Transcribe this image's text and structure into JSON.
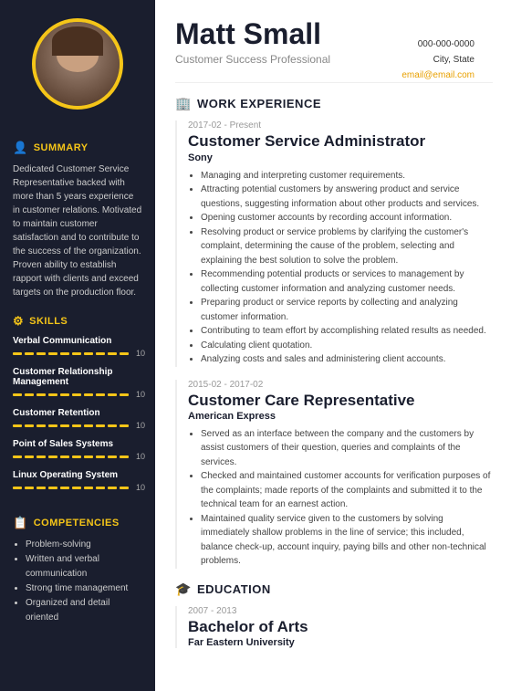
{
  "sidebar": {
    "summary_title": "SUMMARY",
    "summary_text": "Dedicated Customer Service Representative backed with more than 5 years experience in customer relations. Motivated to maintain customer satisfaction and to contribute to the success of the organization. Proven ability to establish rapport with clients and exceed targets on the production floor.",
    "skills_title": "SKILLS",
    "skills": [
      {
        "name": "Verbal Communication",
        "score": 10,
        "filled": 10
      },
      {
        "name": "Customer Relationship Management",
        "score": 10,
        "filled": 10
      },
      {
        "name": "Customer Retention",
        "score": 10,
        "filled": 10
      },
      {
        "name": "Point of Sales Systems",
        "score": 10,
        "filled": 10
      },
      {
        "name": "Linux Operating System",
        "score": 10,
        "filled": 10
      }
    ],
    "competencies_title": "COMPETENCIES",
    "competencies": [
      "Problem-solving",
      "Written and verbal communication",
      "Strong time management",
      "Organized and detail oriented"
    ]
  },
  "header": {
    "name": "Matt Small",
    "title": "Customer Success Professional",
    "phone": "000-000-0000",
    "location": "City, State",
    "email": "email@email.com"
  },
  "work_experience": {
    "title": "WORK EXPERIENCE",
    "jobs": [
      {
        "date": "2017-02 - Present",
        "title": "Customer Service Administrator",
        "company": "Sony",
        "bullets": [
          "Managing and interpreting customer requirements.",
          "Attracting potential customers by answering product and service questions, suggesting information about other products and services.",
          "Opening customer accounts by recording account information.",
          "Resolving product or service problems by clarifying the customer's complaint, determining the cause of the problem, selecting and explaining the best solution to solve the problem.",
          "Recommending potential products or services to management by collecting customer information and analyzing customer needs.",
          "Preparing product or service reports by collecting and analyzing customer information.",
          "Contributing to team effort by accomplishing related results as needed.",
          "Calculating client quotation.",
          "Analyzing costs and sales and administering client accounts."
        ]
      },
      {
        "date": "2015-02 - 2017-02",
        "title": "Customer Care Representative",
        "company": "American Express",
        "bullets": [
          "Served as an interface between the company and the customers by assist customers of their question, queries and complaints of the services.",
          "Checked and maintained customer accounts for verification purposes of the complaints; made reports of the complaints and submitted it to the technical team for an earnest action.",
          "Maintained quality service given to the customers by solving immediately shallow problems in the line of service; this included, balance check-up, account inquiry, paying bills and other non-technical problems."
        ]
      }
    ]
  },
  "education": {
    "title": "EDUCATION",
    "items": [
      {
        "date": "2007 - 2013",
        "degree": "Bachelor of Arts",
        "school": "Far Eastern University"
      }
    ]
  }
}
